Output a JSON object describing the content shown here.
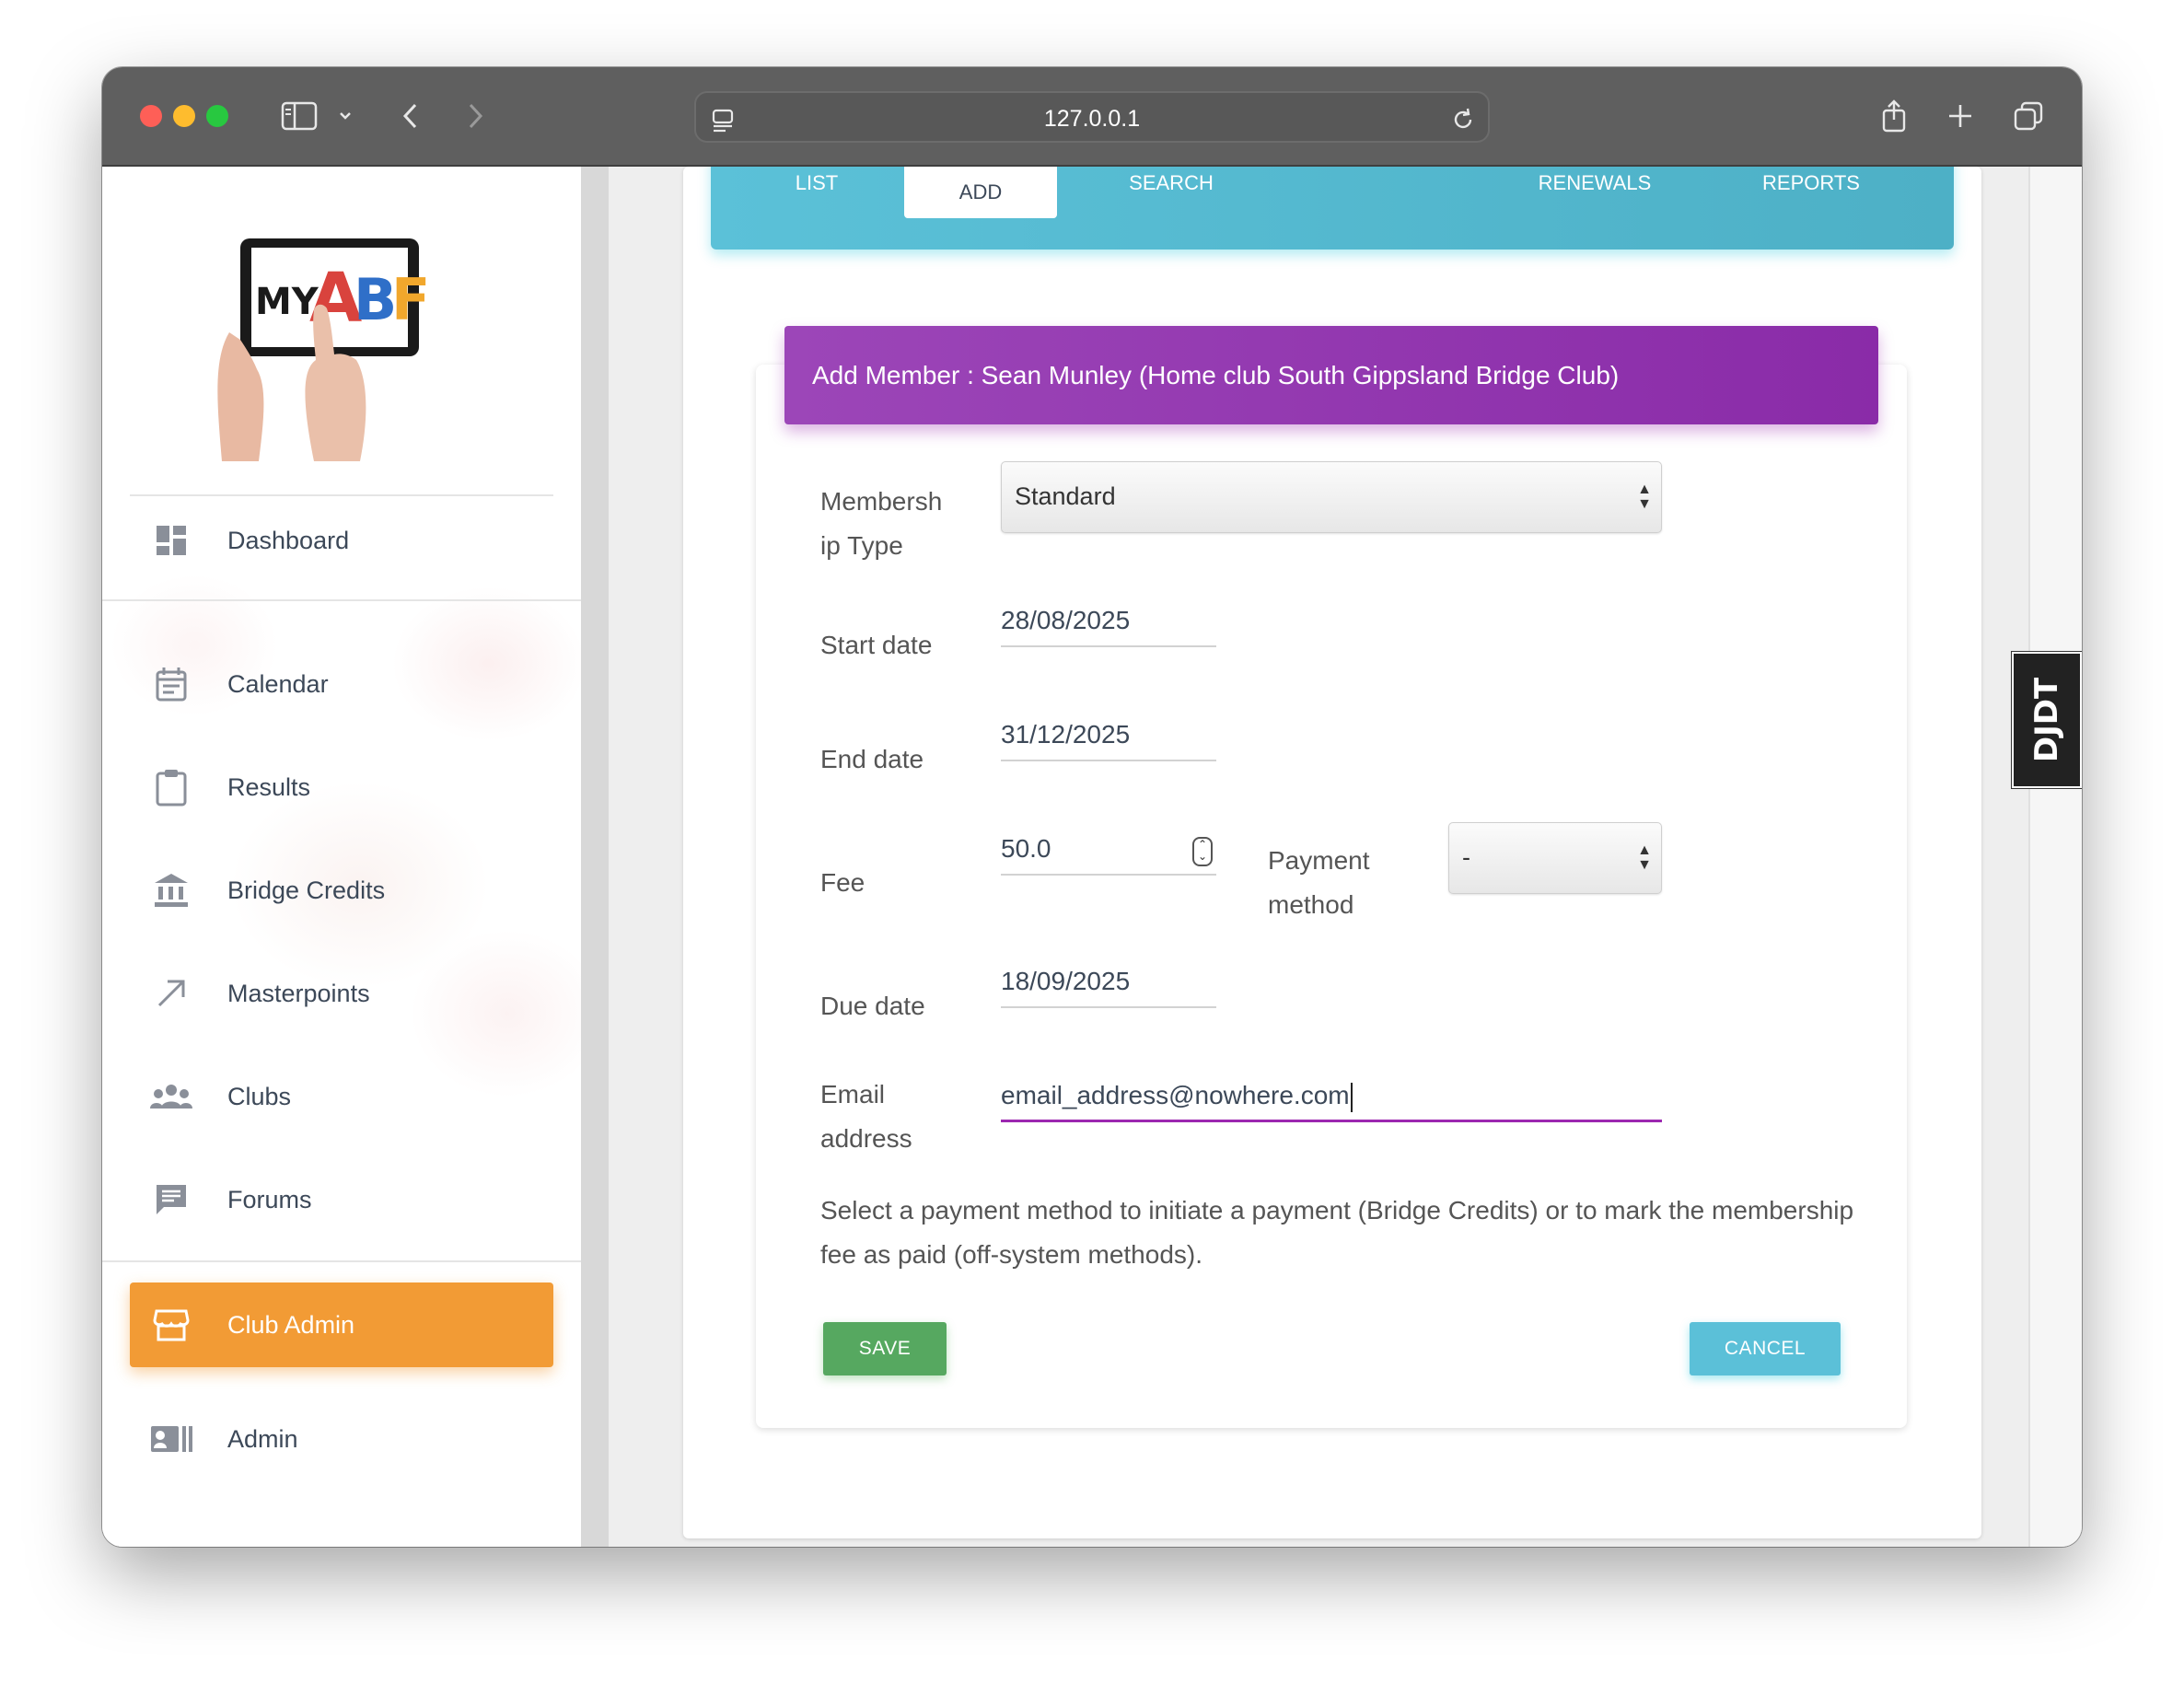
{
  "browser": {
    "url": "127.0.0.1"
  },
  "logo": {
    "text_my": "MY",
    "text_abf": "ABF"
  },
  "sidebar": {
    "items": [
      {
        "label": "Dashboard",
        "icon": "dashboard-icon"
      },
      {
        "label": "Calendar",
        "icon": "calendar-icon"
      },
      {
        "label": "Results",
        "icon": "clipboard-icon"
      },
      {
        "label": "Bridge Credits",
        "icon": "bank-icon"
      },
      {
        "label": "Masterpoints",
        "icon": "arrow-up-right-icon"
      },
      {
        "label": "Clubs",
        "icon": "group-icon"
      },
      {
        "label": "Forums",
        "icon": "chat-icon"
      },
      {
        "label": "Club Admin",
        "icon": "store-icon",
        "active": true
      },
      {
        "label": "Admin",
        "icon": "admin-badge-icon"
      }
    ]
  },
  "tabs": [
    {
      "label": "LIST"
    },
    {
      "label": "ADD",
      "active": true
    },
    {
      "label": "SEARCH"
    },
    {
      "label": "RENEWALS"
    },
    {
      "label": "REPORTS"
    }
  ],
  "form": {
    "header": "Add Member : Sean Munley (Home club South Gippsland Bridge Club)",
    "membership_type_label_1": "Membersh",
    "membership_type_label_2": "ip Type",
    "membership_type_value": "Standard",
    "start_date_label": "Start date",
    "start_date_value": "28/08/2025",
    "end_date_label": "End date",
    "end_date_value": "31/12/2025",
    "fee_label": "Fee",
    "fee_value": "50.0",
    "payment_method_label_1": "Payment",
    "payment_method_label_2": "method",
    "payment_method_value": "-",
    "due_date_label": "Due date",
    "due_date_value": "18/09/2025",
    "email_label_1": "Email",
    "email_label_2": "address",
    "email_value": "email_address@nowhere.com",
    "help_text": "Select a payment method to initiate a payment (Bridge Credits) or to mark the membership fee as paid (off-system methods).",
    "save_label": "SAVE",
    "cancel_label": "CANCEL"
  },
  "debug_toolbar": {
    "label": "DJDT"
  },
  "colors": {
    "tabs_bar": "#5bc1d8",
    "form_header": "#9c46b8",
    "active_nav": "#f29b35",
    "save_button": "#56a860",
    "cancel_button": "#5bc0d8"
  }
}
